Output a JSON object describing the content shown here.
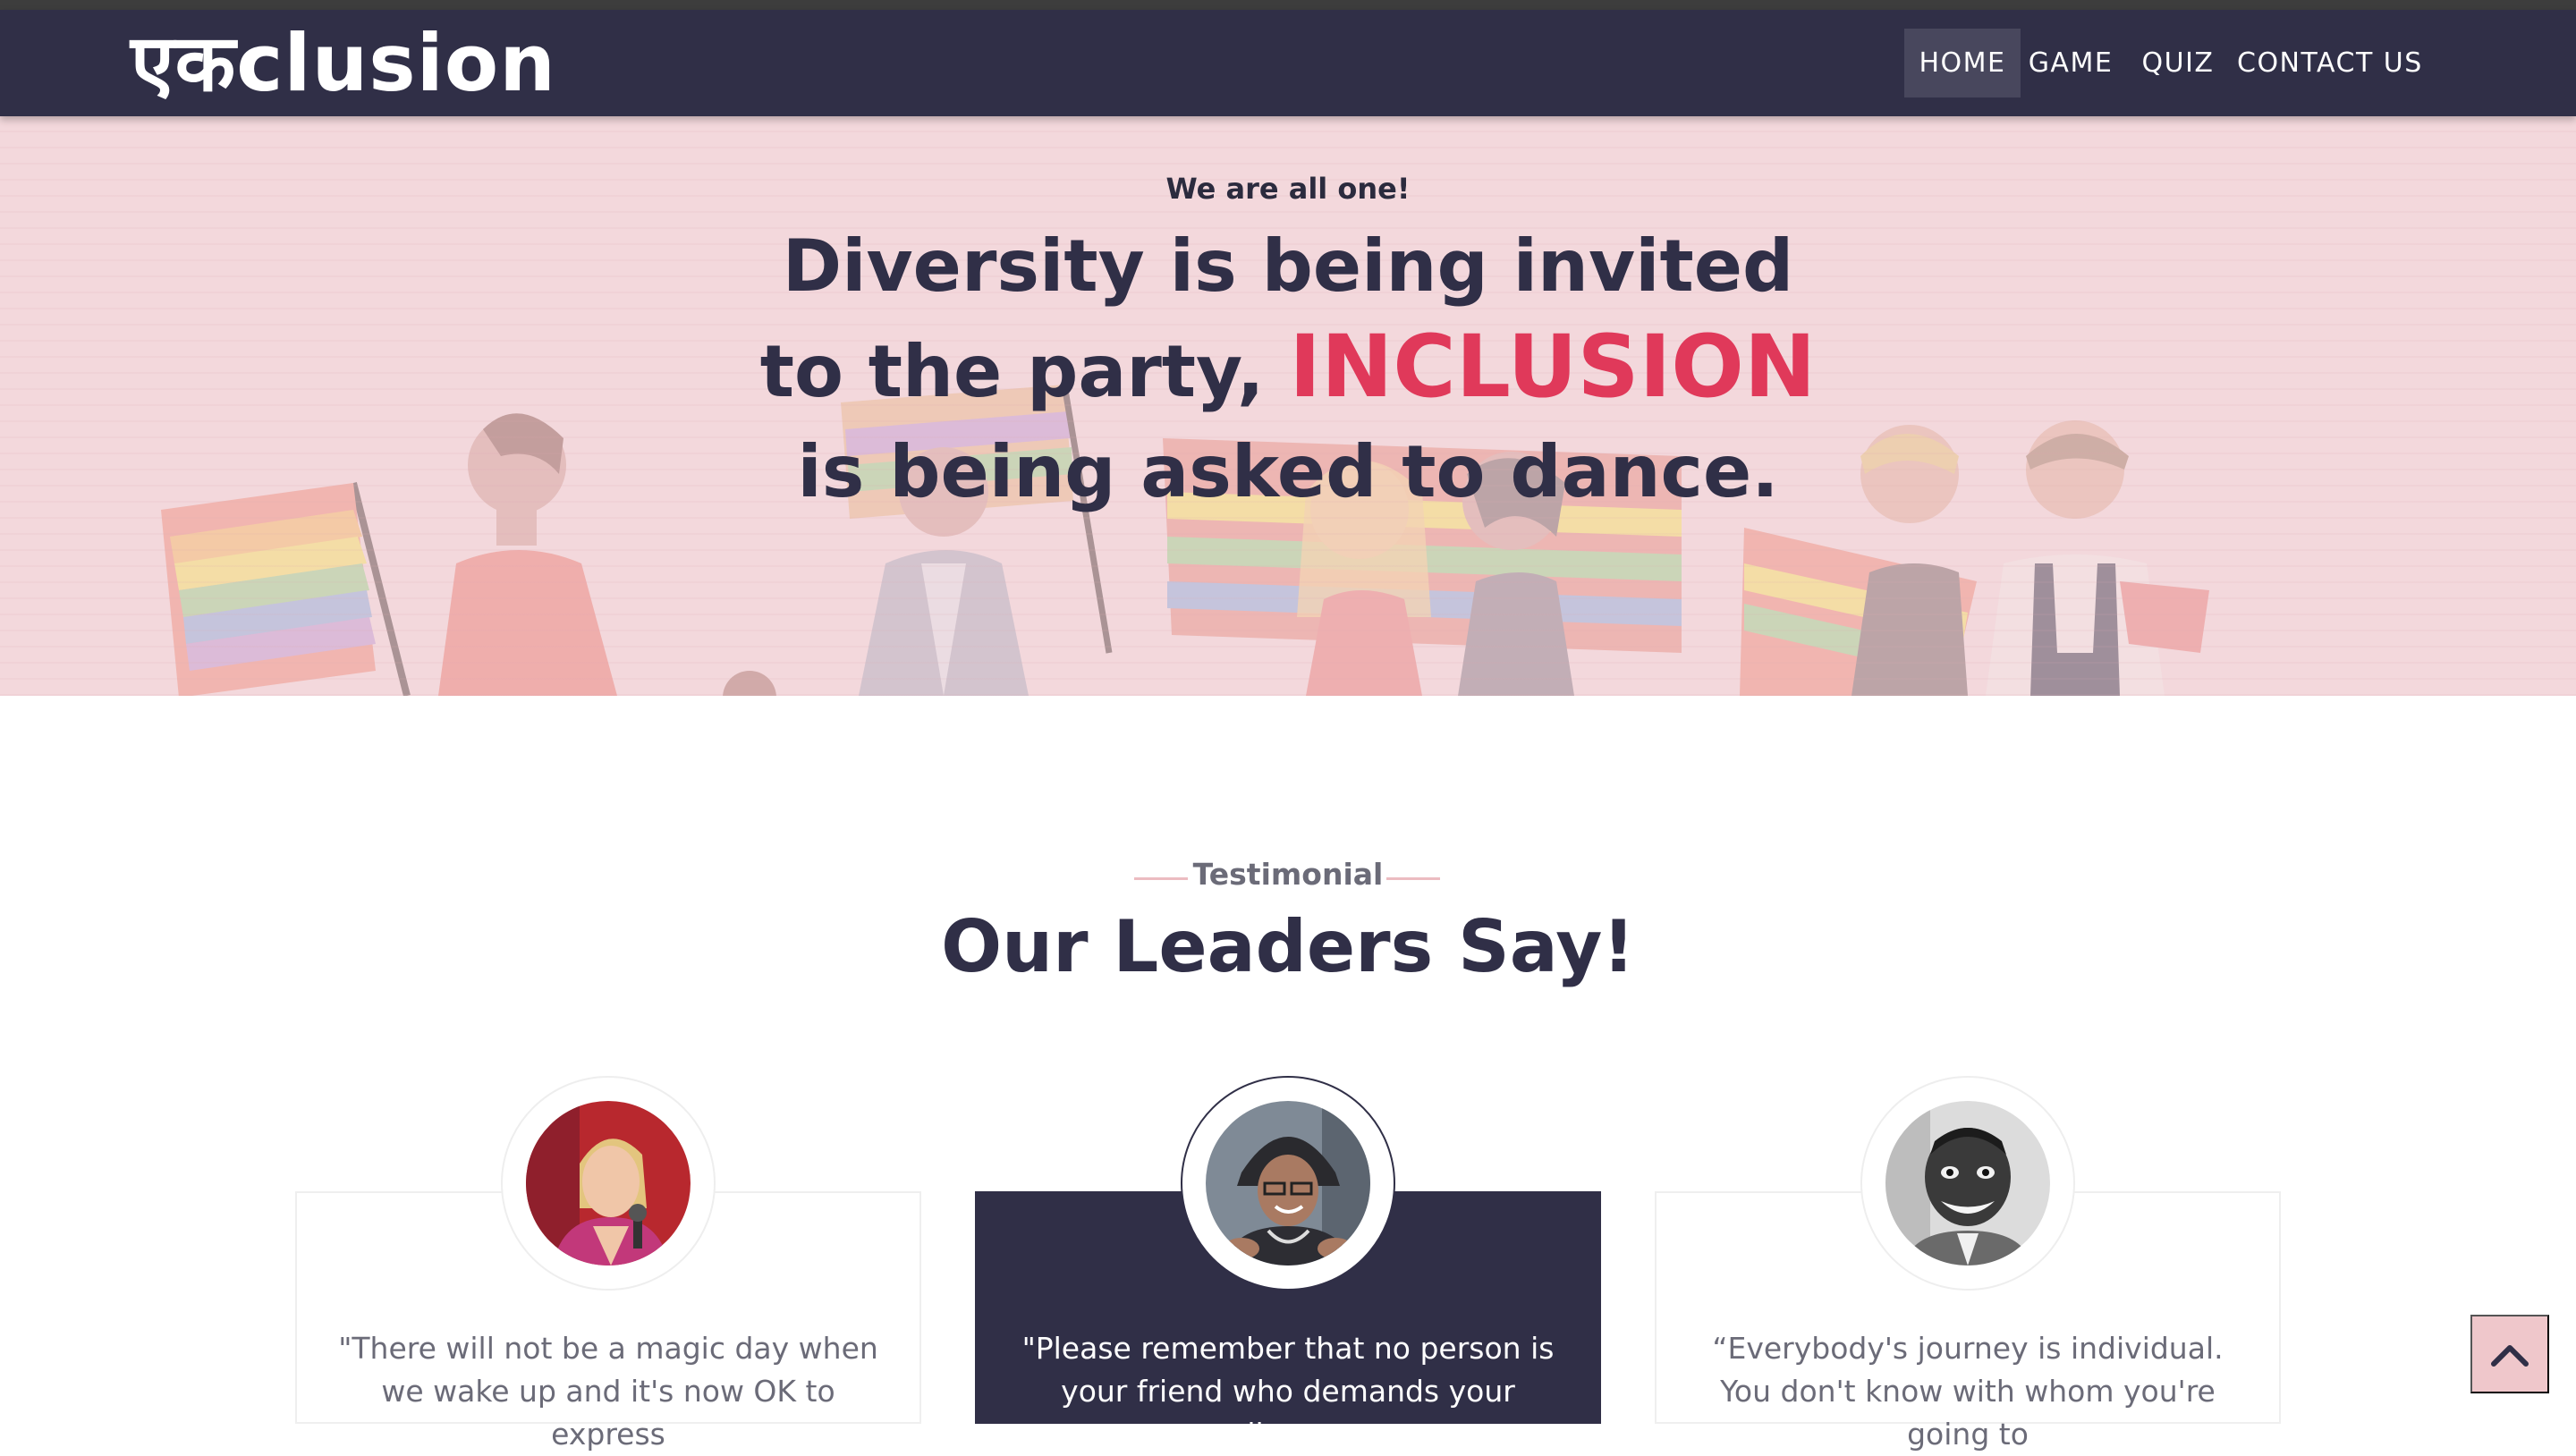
{
  "brand": {
    "name": "एकclusion"
  },
  "nav": {
    "items": [
      {
        "label": "HOME",
        "active": true
      },
      {
        "label": "GAME",
        "active": false
      },
      {
        "label": "QUIZ",
        "active": false
      },
      {
        "label": "CONTACT US",
        "active": false
      }
    ]
  },
  "hero": {
    "tagline": "We are all one!",
    "title_part1": "Diversity is being invited to the party, ",
    "title_highlight": "INCLUSION",
    "title_part2": " is being asked to dance."
  },
  "testimonials": {
    "eyebrow": "Testimonial",
    "title": "Our Leaders Say!",
    "items": [
      {
        "quote": "\"There will not be a magic day when we wake up and it's now OK to express",
        "style": "light"
      },
      {
        "quote": "\"Please remember that no person is your friend who demands your silence,",
        "style": "dark"
      },
      {
        "quote": "“Everybody's journey is individual. You don't know with whom you're going to",
        "style": "light"
      }
    ]
  },
  "colors": {
    "navbar": "#302f47",
    "hero_bg": "#f3d8dc",
    "accent": "#e0395a",
    "card_dark": "#302f47",
    "scroll_button": "#efc7cb"
  },
  "icons": {
    "scroll_top": "chevron-up-icon"
  }
}
